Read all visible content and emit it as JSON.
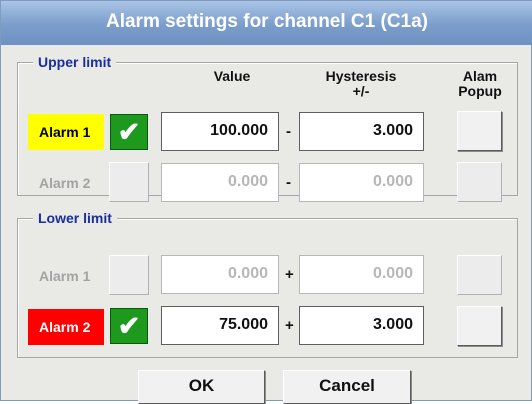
{
  "dialog": {
    "title": "Alarm settings for channel C1 (C1a)"
  },
  "columns": {
    "value": "Value",
    "hysteresis": "Hysteresis",
    "hysteresis_sub": "+/-",
    "alarm": "Alam",
    "popup": "Popup"
  },
  "upper": {
    "legend": "Upper limit",
    "sign": "-",
    "rows": [
      {
        "label": "Alarm 1",
        "enabled": true,
        "check": "✔",
        "value": "100.000",
        "hysteresis": "3.000",
        "label_color": "#ffff00"
      },
      {
        "label": "Alarm 2",
        "enabled": false,
        "value": "0.000",
        "hysteresis": "0.000"
      }
    ]
  },
  "lower": {
    "legend": "Lower limit",
    "sign": "+",
    "rows": [
      {
        "label": "Alarm 1",
        "enabled": false,
        "value": "0.000",
        "hysteresis": "0.000"
      },
      {
        "label": "Alarm 2",
        "enabled": true,
        "check": "✔",
        "value": "75.000",
        "hysteresis": "3.000",
        "label_color": "#ff0000"
      }
    ]
  },
  "footer": {
    "ok": "OK",
    "cancel": "Cancel"
  },
  "colors": {
    "title_bar": "#7a9dcb",
    "legend_text": "#1a2ea0",
    "check_green": "#1d9a1d"
  }
}
